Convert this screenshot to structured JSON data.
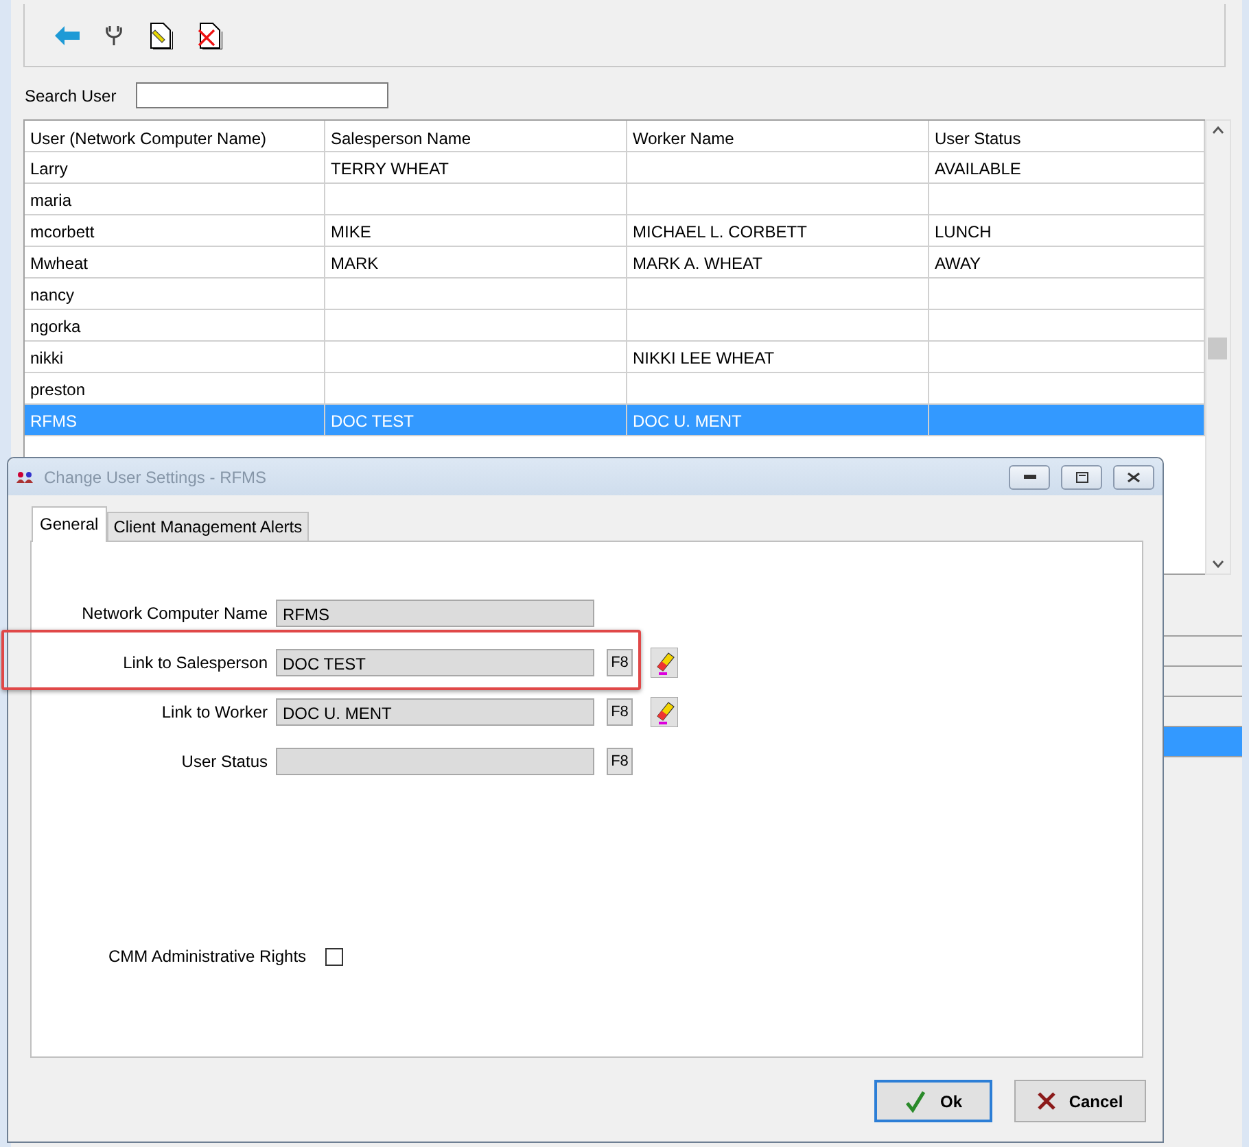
{
  "search": {
    "label": "Search User"
  },
  "table": {
    "columns": [
      "User (Network Computer Name)",
      "Salesperson Name",
      "Worker Name",
      "User Status"
    ],
    "rows": [
      {
        "cells": [
          "Larry",
          "TERRY WHEAT",
          "",
          "AVAILABLE"
        ],
        "selected": false
      },
      {
        "cells": [
          "maria",
          "",
          "",
          ""
        ],
        "selected": false
      },
      {
        "cells": [
          "mcorbett",
          "MIKE",
          "MICHAEL L. CORBETT",
          "LUNCH"
        ],
        "selected": false
      },
      {
        "cells": [
          "Mwheat",
          "MARK",
          "MARK A. WHEAT",
          "AWAY"
        ],
        "selected": false
      },
      {
        "cells": [
          "nancy",
          "",
          "",
          ""
        ],
        "selected": false
      },
      {
        "cells": [
          "ngorka",
          "",
          "",
          ""
        ],
        "selected": false
      },
      {
        "cells": [
          "nikki",
          "",
          "NIKKI LEE WHEAT",
          ""
        ],
        "selected": false
      },
      {
        "cells": [
          "preston",
          "",
          "",
          ""
        ],
        "selected": false
      },
      {
        "cells": [
          "RFMS",
          "DOC TEST",
          "DOC U. MENT",
          ""
        ],
        "selected": true
      }
    ]
  },
  "dialog": {
    "title": "Change User Settings - RFMS",
    "tabs": [
      {
        "label": "General",
        "selected": true
      },
      {
        "label": "Client Management Alerts",
        "selected": false
      }
    ],
    "fields": [
      {
        "label": "Network Computer Name",
        "value": "RFMS",
        "clear": false,
        "highlighted": false
      },
      {
        "label": "Link to Salesperson",
        "value": "DOC TEST",
        "lookup": "F8",
        "clear": true,
        "highlighted": true
      },
      {
        "label": "Link to Worker",
        "value": "DOC U. MENT",
        "lookup": "F8",
        "clear": true,
        "highlighted": false
      },
      {
        "label": "User Status",
        "lookup": "F8",
        "clear": false,
        "highlighted": false
      }
    ],
    "checkbox": {
      "label": "CMM Administrative Rights",
      "checked": false
    },
    "buttons": [
      {
        "kind": "ok",
        "label": "Ok",
        "default": true
      },
      {
        "kind": "cancel",
        "label": "Cancel",
        "default": false
      }
    ]
  }
}
